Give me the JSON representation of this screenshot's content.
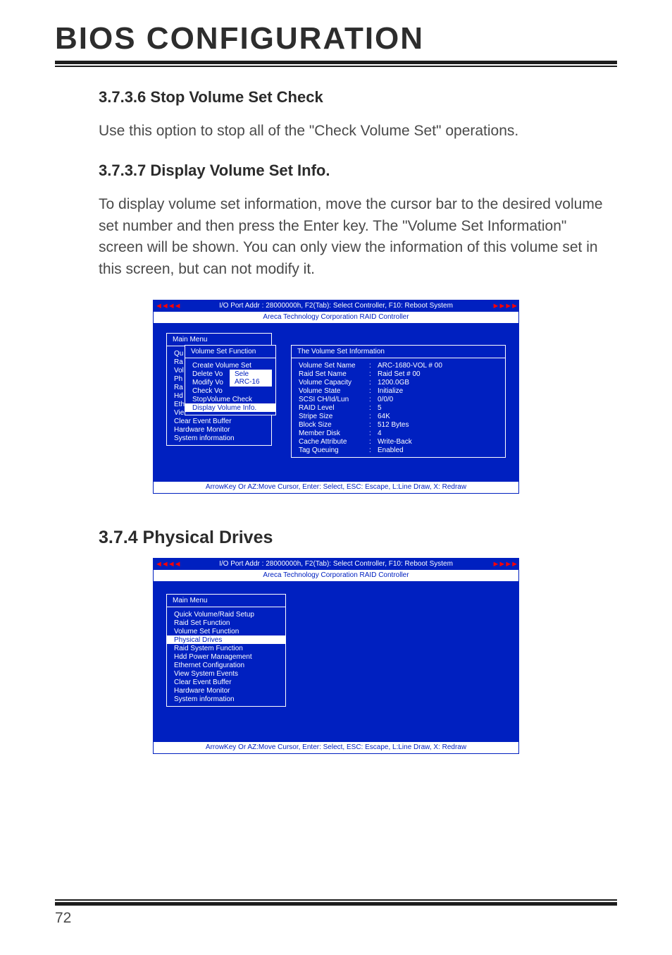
{
  "page": {
    "title": "BIOS CONFIGURATION",
    "number": "72"
  },
  "sec1": {
    "heading": "3.7.3.6 Stop Volume Set Check",
    "body": "Use this option to stop all of the \"Check Volume Set\" operations."
  },
  "sec2": {
    "heading": "3.7.3.7 Display Volume Set Info.",
    "body": "To display volume set information, move the cursor bar to the desired volume set number and then press the Enter key. The \"Volume Set Information\" screen will be shown. You can only view the information of this volume set in this screen, but can not modify it."
  },
  "sec3": {
    "heading": "3.7.4 Physical Drives"
  },
  "bios_common": {
    "topbar": "I/O Port Addr : 28000000h, F2(Tab): Select Controller, F10: Reboot System",
    "subtitle": "Areca Technology Corporation RAID Controller",
    "footer": "ArrowKey Or AZ:Move Cursor, Enter: Select, ESC: Escape, L:Line Draw, X: Redraw",
    "arrow_left": "◄◄◄◄",
    "arrow_right": "►►►►"
  },
  "bios1": {
    "main_title": "Main Menu",
    "main_items_left": [
      "Qu",
      "Ra",
      "Vol",
      "Ph",
      "Ra",
      "Hd",
      "Eth",
      "Vie"
    ],
    "main_rest": [
      "Clear Event Buffer",
      "Hardware Monitor",
      "System information"
    ],
    "vsf_title": "Volume Set Function",
    "vsf_items": [
      "Create Volume Set",
      "Delete Vo",
      "Modify Vo",
      "Check Vo",
      "StopVolume Check",
      "Display Volume Info."
    ],
    "sele_tag": "Sele",
    "sele_val": "ARC-16",
    "info_title": "The Volume Set Information",
    "info_rows": [
      {
        "label": "Volume Set Name",
        "value": "ARC-1680-VOL #  00"
      },
      {
        "label": "Raid Set Name",
        "value": "Raid Set  #  00"
      },
      {
        "label": "Volume Capacity",
        "value": "1200.0GB"
      },
      {
        "label": "Volume State",
        "value": "Initialize"
      },
      {
        "label": "SCSI  CH/Id/Lun",
        "value": "0/0/0"
      },
      {
        "label": "RAID Level",
        "value": "5"
      },
      {
        "label": "Stripe Size",
        "value": "64K"
      },
      {
        "label": "Block  Size",
        "value": "512 Bytes"
      },
      {
        "label": "Member Disk",
        "value": "4"
      },
      {
        "label": "Cache Attribute",
        "value": "Write-Back"
      },
      {
        "label": "Tag Queuing",
        "value": "Enabled"
      }
    ]
  },
  "bios2": {
    "main_title": "Main Menu",
    "items": [
      {
        "label": "Quick Volume/Raid Setup",
        "sel": false
      },
      {
        "label": "Raid Set Function",
        "sel": false
      },
      {
        "label": "Volume Set Function",
        "sel": false
      },
      {
        "label": "Physical Drives",
        "sel": true
      },
      {
        "label": "Raid System Function",
        "sel": false
      },
      {
        "label": "Hdd Power Management",
        "sel": false
      },
      {
        "label": "Ethernet Configuration",
        "sel": false
      },
      {
        "label": "View System Events",
        "sel": false
      },
      {
        "label": "Clear Event Buffer",
        "sel": false
      },
      {
        "label": "Hardware Monitor",
        "sel": false
      },
      {
        "label": "System information",
        "sel": false
      }
    ]
  }
}
